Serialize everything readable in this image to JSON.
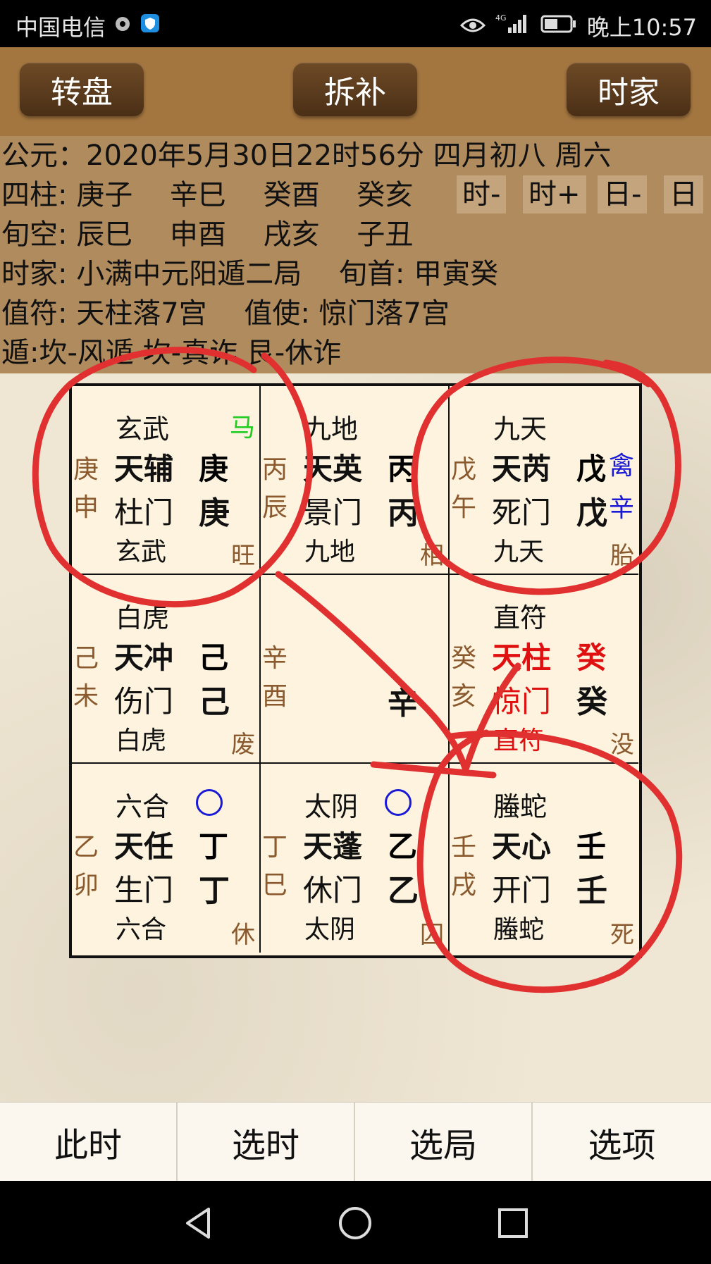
{
  "status_bar": {
    "carrier": "中国电信",
    "network": "4G",
    "time": "晚上10:57"
  },
  "toolbar": {
    "left": "转盘",
    "center": "拆补",
    "right": "时家"
  },
  "info": {
    "line1": "公元：2020年5月30日22时56分 四月初八 周六",
    "line2_label": "四柱: 庚子　 辛巳　 癸酉　 癸亥",
    "line3": "旬空: 辰巳　 申酉　 戌亥　 子丑",
    "line4": "时家: 小满中元阳遁二局　 旬首: 甲寅癸",
    "line5": "值符: 天柱落7宫　 值使: 惊门落7宫",
    "line6": "遁:坎-风遁 坎-真诈 艮-休诈",
    "nav": {
      "hour_minus": "时-",
      "hour_plus": "时+",
      "day_minus": "日-",
      "day_plus": "日"
    }
  },
  "palaces": [
    {
      "stem1": "庚",
      "stem2": "申",
      "deity": "玄武",
      "star": "天辅",
      "star_stem": "庚",
      "door": "杜门",
      "earth_stem": "庚",
      "deity2": "玄武",
      "state": "旺",
      "tag": "马"
    },
    {
      "stem1": "丙",
      "stem2": "辰",
      "deity": "九地",
      "star": "天英",
      "star_stem": "丙",
      "door": "景门",
      "earth_stem": "丙",
      "deity2": "九地",
      "state": "相"
    },
    {
      "stem1": "戊",
      "stem2": "午",
      "deity": "九天",
      "star": "天芮",
      "star_stem": "戊",
      "door": "死门",
      "earth_stem": "戊",
      "deity2": "九天",
      "state": "胎",
      "tag": "禽",
      "tag2": "辛"
    },
    {
      "stem1": "己",
      "stem2": "未",
      "deity": "白虎",
      "star": "天冲",
      "star_stem": "己",
      "door": "伤门",
      "earth_stem": "己",
      "deity2": "白虎",
      "state": "废"
    },
    {
      "stem1": "辛",
      "stem2": "酉",
      "earth_stem": "辛"
    },
    {
      "stem1": "癸",
      "stem2": "亥",
      "deity": "直符",
      "star": "天柱",
      "star_stem": "癸",
      "door": "惊门",
      "earth_stem": "癸",
      "deity2": "直符",
      "state": "没"
    },
    {
      "stem1": "乙",
      "stem2": "卯",
      "deity": "六合",
      "star": "天任",
      "star_stem": "丁",
      "door": "生门",
      "earth_stem": "丁",
      "deity2": "六合",
      "state": "休"
    },
    {
      "stem1": "丁",
      "stem2": "巳",
      "deity": "太阴",
      "star": "天蓬",
      "star_stem": "乙",
      "door": "休门",
      "earth_stem": "乙",
      "deity2": "太阴",
      "state": "囚"
    },
    {
      "stem1": "壬",
      "stem2": "戌",
      "deity": "螣蛇",
      "star": "天心",
      "star_stem": "壬",
      "door": "开门",
      "earth_stem": "壬",
      "deity2": "螣蛇",
      "state": "死"
    }
  ],
  "colors": {
    "red": "#e01010",
    "tag_green": "#22cc22",
    "tag_blue": "#1a1ad6",
    "annotation": "#e03030"
  },
  "bottom_bar": {
    "now": "此时",
    "select_time": "选时",
    "select_ju": "选局",
    "options": "选项"
  }
}
